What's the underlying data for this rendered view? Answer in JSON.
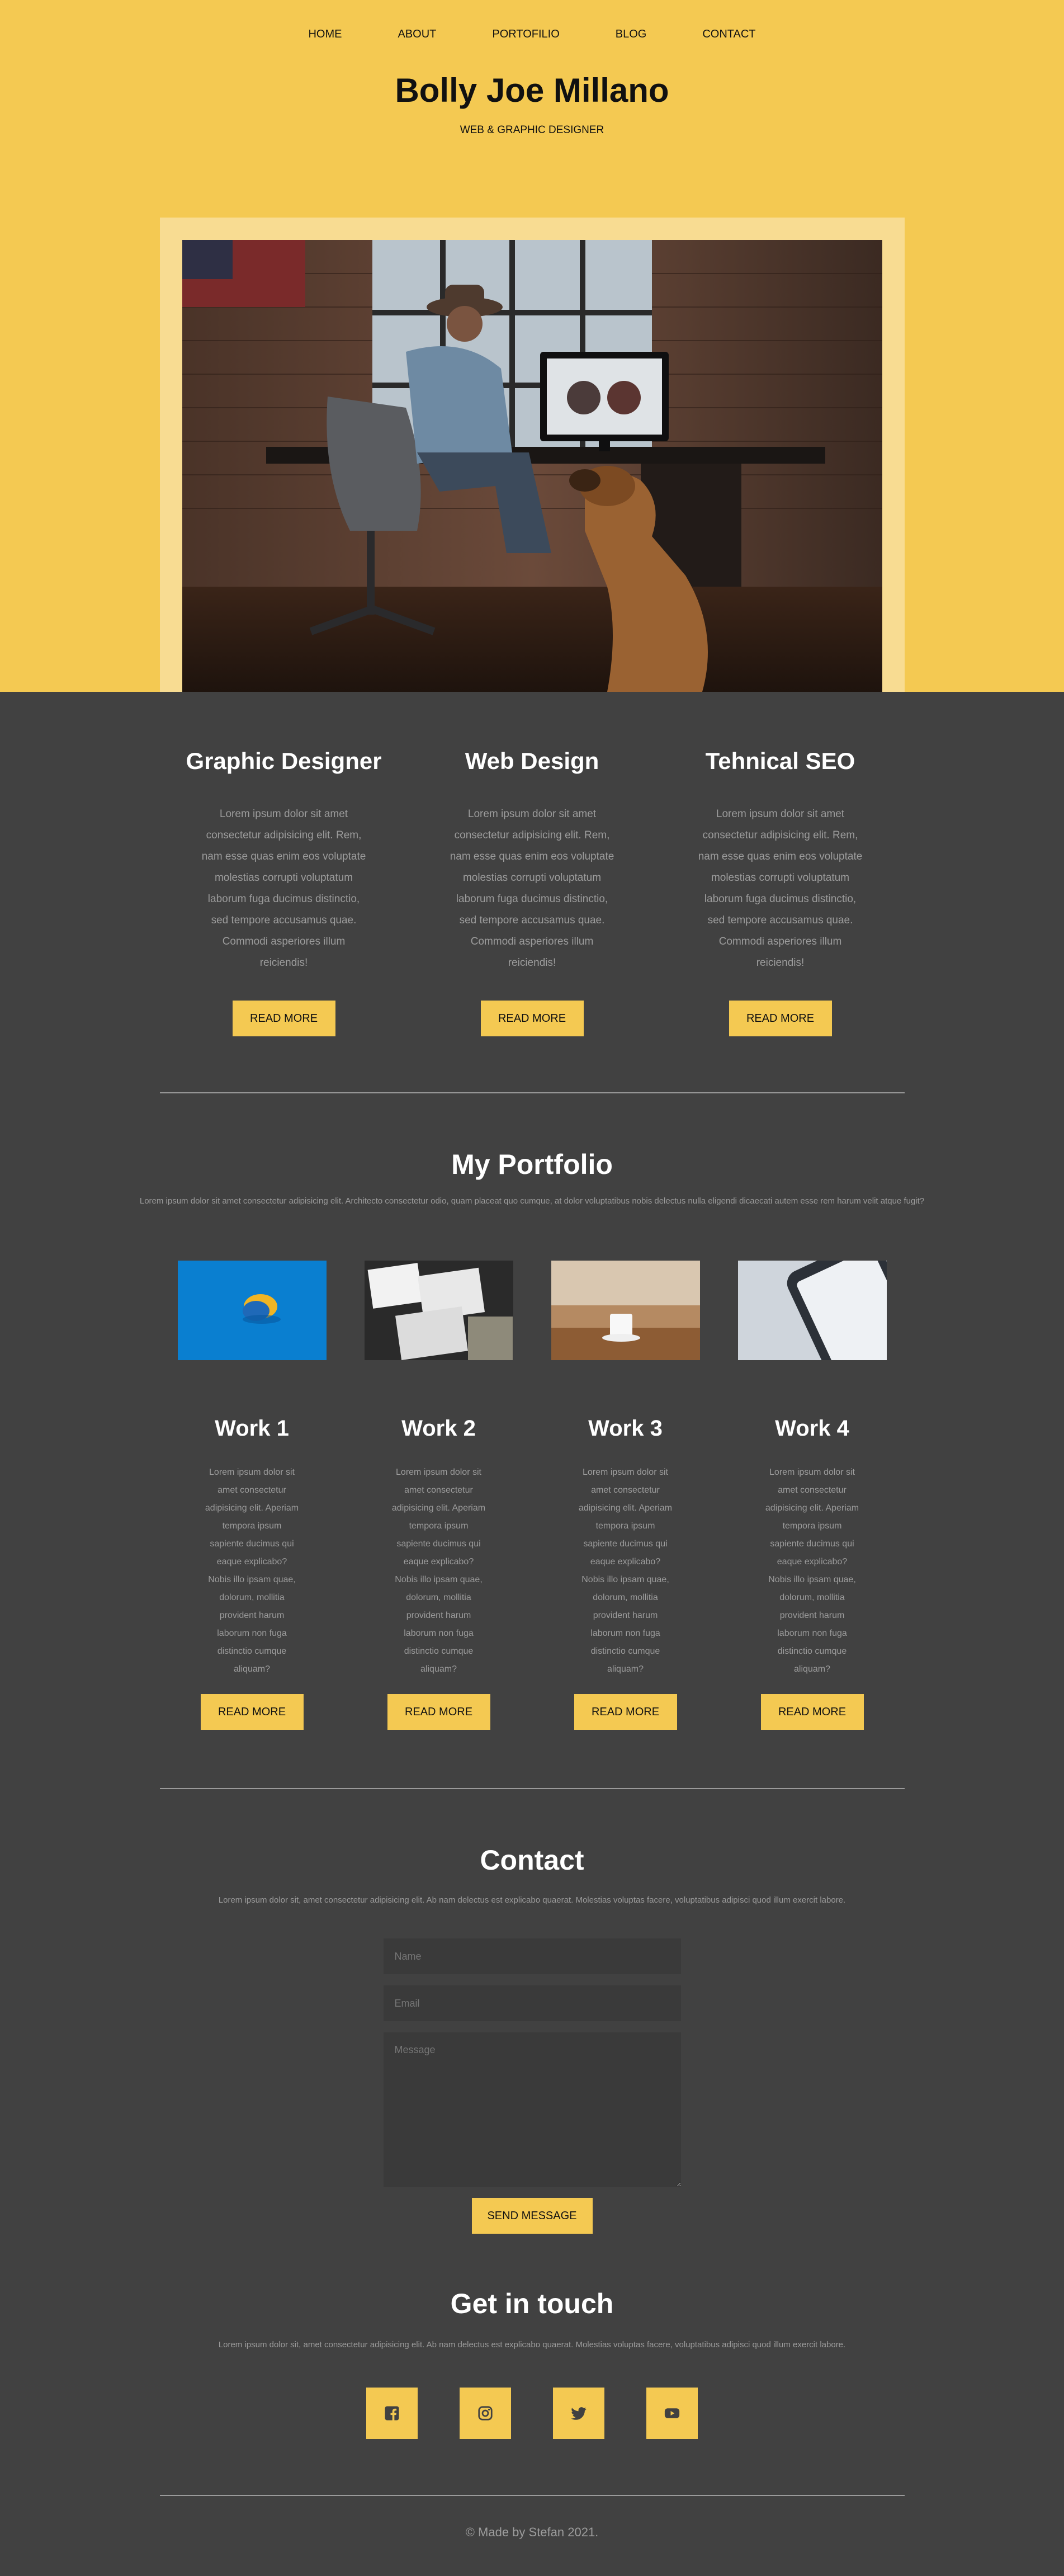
{
  "nav": {
    "items": [
      "HOME",
      "ABOUT",
      "PORTOFILIO",
      "BLOG",
      "CONTACT"
    ]
  },
  "header": {
    "title": "Bolly Joe Millano",
    "subtitle": "WEB & GRAPHIC DESIGNER"
  },
  "services": [
    {
      "title": "Graphic Designer",
      "text": "Lorem ipsum dolor sit amet consectetur adipisicing elit. Rem, nam esse quas enim eos voluptate molestias corrupti voluptatum laborum fuga ducimus distinctio, sed tempore accusamus quae. Commodi asperiores illum reiciendis!",
      "button": "READ MORE"
    },
    {
      "title": "Web Design",
      "text": "Lorem ipsum dolor sit amet consectetur adipisicing elit. Rem, nam esse quas enim eos voluptate molestias corrupti voluptatum laborum fuga ducimus distinctio, sed tempore accusamus quae. Commodi asperiores illum reiciendis!",
      "button": "READ MORE"
    },
    {
      "title": "Tehnical SEO",
      "text": "Lorem ipsum dolor sit amet consectetur adipisicing elit. Rem, nam esse quas enim eos voluptate molestias corrupti voluptatum laborum fuga ducimus distinctio, sed tempore accusamus quae. Commodi asperiores illum reiciendis!",
      "button": "READ MORE"
    }
  ],
  "portfolio": {
    "title": "My Portfolio",
    "subtitle": "Lorem ipsum dolor sit amet consectetur adipisicing elit. Architecto consectetur odio, quam placeat quo cumque, at dolor voluptatibus nobis delectus nulla eligendi dicaecati autem esse rem harum velit atque fugit?",
    "works": [
      {
        "title": "Work 1",
        "text": "Lorem ipsum dolor sit amet consectetur adipisicing elit. Aperiam tempora ipsum sapiente ducimus qui eaque explicabo? Nobis illo ipsam quae, dolorum, mollitia provident harum laborum non fuga distinctio cumque aliquam?",
        "button": "READ MORE"
      },
      {
        "title": "Work 2",
        "text": "Lorem ipsum dolor sit amet consectetur adipisicing elit. Aperiam tempora ipsum sapiente ducimus qui eaque explicabo? Nobis illo ipsam quae, dolorum, mollitia provident harum laborum non fuga distinctio cumque aliquam?",
        "button": "READ MORE"
      },
      {
        "title": "Work 3",
        "text": "Lorem ipsum dolor sit amet consectetur adipisicing elit. Aperiam tempora ipsum sapiente ducimus qui eaque explicabo? Nobis illo ipsam quae, dolorum, mollitia provident harum laborum non fuga distinctio cumque aliquam?",
        "button": "READ MORE"
      },
      {
        "title": "Work 4",
        "text": "Lorem ipsum dolor sit amet consectetur adipisicing elit. Aperiam tempora ipsum sapiente ducimus qui eaque explicabo? Nobis illo ipsam quae, dolorum, mollitia provident harum laborum non fuga distinctio cumque aliquam?",
        "button": "READ MORE"
      }
    ]
  },
  "contact": {
    "title": "Contact",
    "subtitle": "Lorem ipsum dolor sit, amet consectetur adipisicing elit. Ab nam delectus est explicabo quaerat. Molestias voluptas facere, voluptatibus adipisci quod illum exercit labore.",
    "name_placeholder": "Name",
    "email_placeholder": "Email",
    "message_placeholder": "Message",
    "send_label": "SEND MESSAGE"
  },
  "touch": {
    "title": "Get in touch",
    "subtitle": "Lorem ipsum dolor sit, amet consectetur adipisicing elit. Ab nam delectus est explicabo quaerat. Molestias voluptas facere, voluptatibus adipisci quod illum exercit labore.",
    "socials": [
      "facebook-icon",
      "instagram-icon",
      "twitter-icon",
      "youtube-icon"
    ]
  },
  "footer": {
    "text": "© Made by Stefan 2021."
  },
  "colors": {
    "accent": "#f4c952",
    "background": "#414141",
    "muted_text": "#9c9c9c"
  }
}
